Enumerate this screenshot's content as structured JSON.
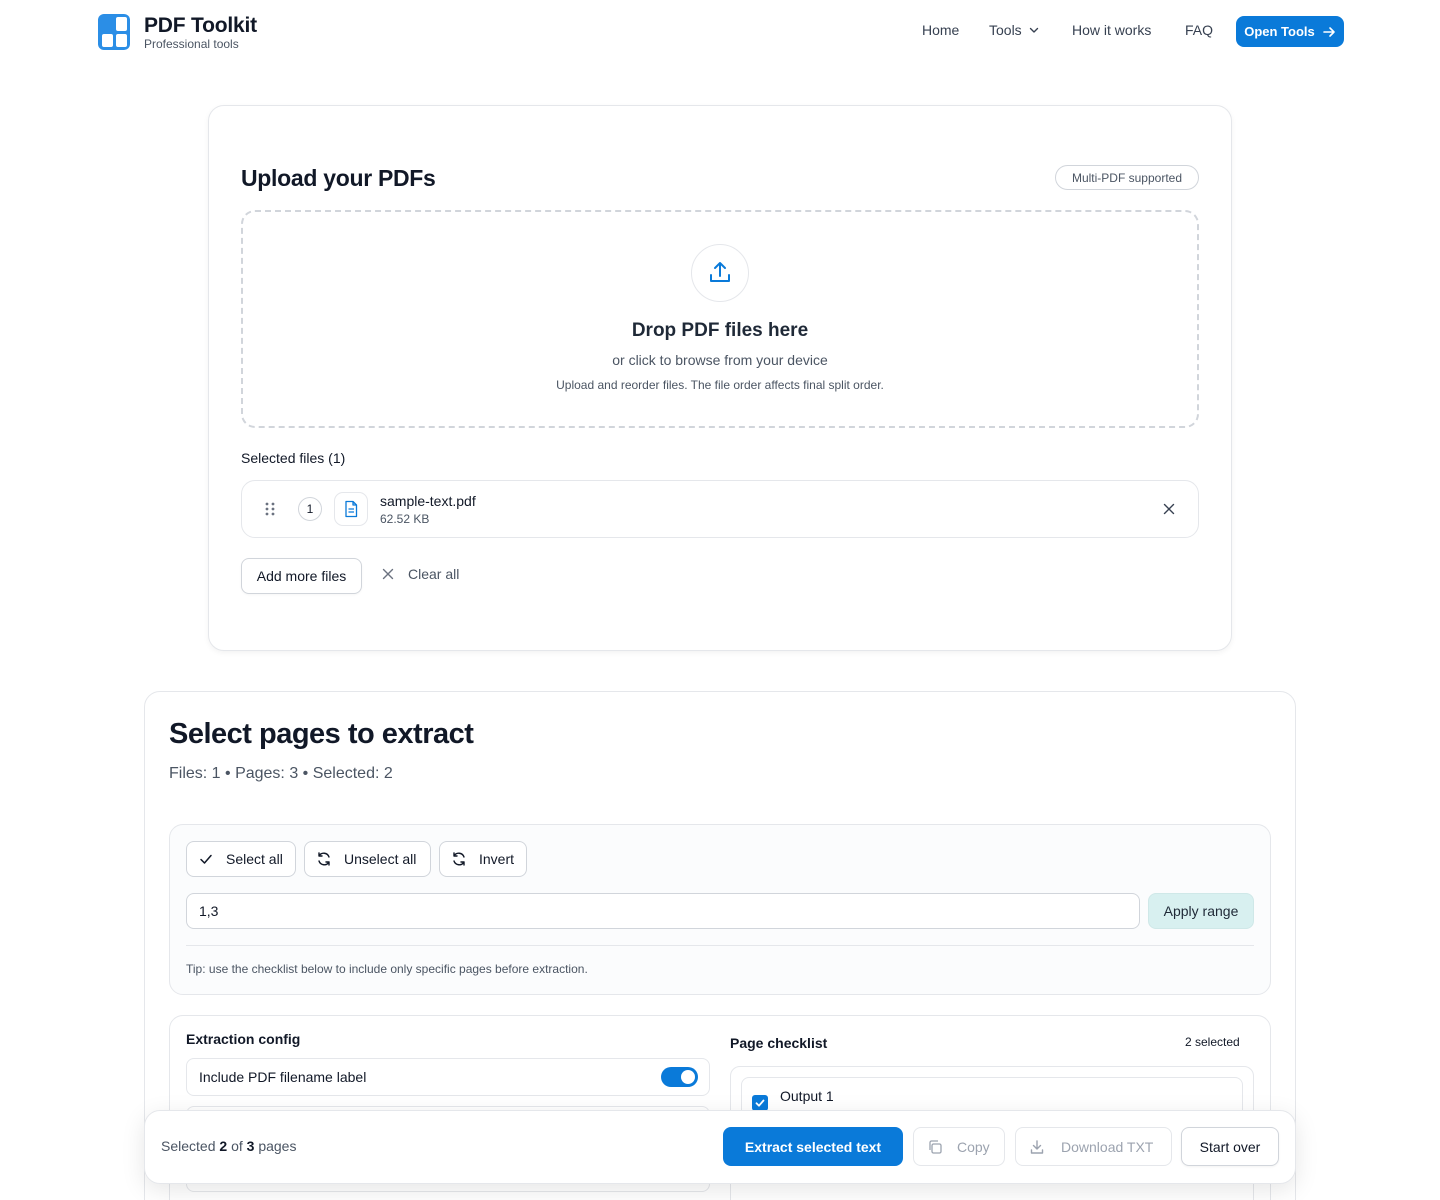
{
  "brand": {
    "title": "PDF Toolkit",
    "subtitle": "Professional tools",
    "accent": "#0a7ad9"
  },
  "nav": {
    "home": "Home",
    "tools": "Tools",
    "how": "How it works",
    "faq": "FAQ",
    "cta": "Open Tools"
  },
  "upload": {
    "title": "Upload your PDFs",
    "badge": "Multi-PDF supported",
    "drop_title": "Drop PDF files here",
    "drop_sub": "or click to browse from your device",
    "drop_note": "Upload and reorder files. The file order affects final split order.",
    "selected_label": "Selected files (1)",
    "files": [
      {
        "index": "1",
        "name": "sample-text.pdf",
        "size": "62.52 KB"
      }
    ],
    "add_more": "Add more files",
    "clear_all": "Clear all"
  },
  "pages": {
    "title": "Select pages to extract",
    "meta": "Files: 1 • Pages: 3 • Selected: 2",
    "select_all": "Select all",
    "unselect_all": "Unselect all",
    "invert": "Invert",
    "range_value": "1,3",
    "apply_range": "Apply range",
    "tip": "Tip: use the checklist below to include only specific pages before extraction."
  },
  "config": {
    "title": "Extraction config",
    "option1": "Include PDF filename label",
    "option1_enabled": true
  },
  "checklist": {
    "title": "Page checklist",
    "count": "2 selected",
    "items": [
      {
        "label": "Output 1",
        "checked": true
      }
    ]
  },
  "actions": {
    "summary_prefix": "Selected",
    "selected": "2",
    "of": "of",
    "total": "3",
    "summary_suffix": "pages",
    "extract": "Extract selected text",
    "copy": "Copy",
    "download": "Download TXT",
    "start_over": "Start over"
  }
}
